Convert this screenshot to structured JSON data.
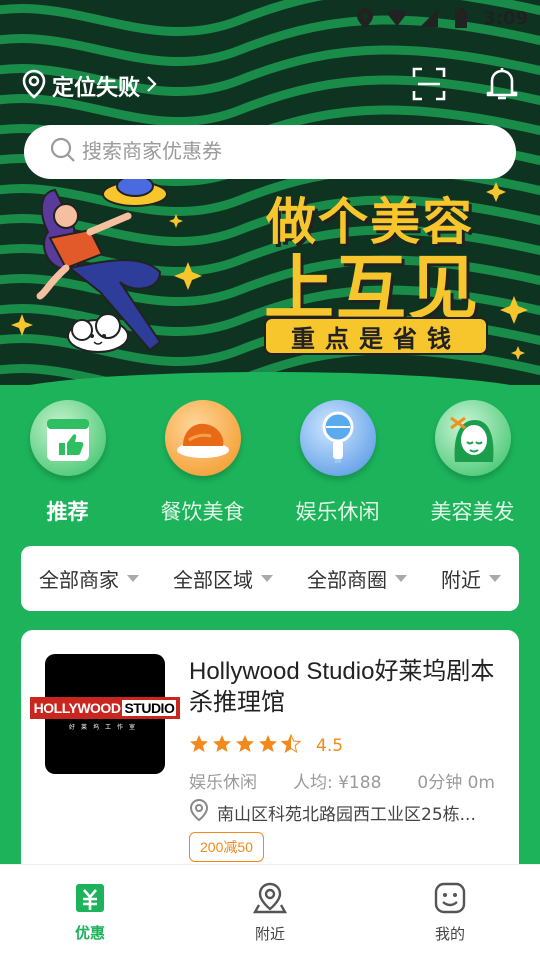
{
  "status": {
    "time": "3:09"
  },
  "header": {
    "location_label": "定位失败"
  },
  "search": {
    "placeholder": "搜索商家优惠券"
  },
  "banner": {
    "line1": "做个美容",
    "line2": "上互见",
    "pill": "重点是省钱"
  },
  "categories": [
    {
      "label": "推荐",
      "active": true
    },
    {
      "label": "餐饮美食",
      "active": false
    },
    {
      "label": "娱乐休闲",
      "active": false
    },
    {
      "label": "美容美发",
      "active": false
    }
  ],
  "filters": [
    "全部商家",
    "全部区域",
    "全部商圈",
    "附近"
  ],
  "merchant": {
    "name": "Hollywood Studio好莱坞剧本杀推理馆",
    "logo_text_1": "HOLLYWOOD",
    "logo_text_2": "STUDIO",
    "logo_sub": "好莱坞工作室",
    "rating": 4.5,
    "rating_text": "4.5",
    "category": "娱乐休闲",
    "avg_price": "人均: ¥188",
    "distance": "0分钟 0m",
    "address": "南山区科苑北路园西工业区25栋...",
    "tag": "200减50"
  },
  "bottom_nav": [
    {
      "label": "优惠",
      "icon": "coupon-icon",
      "active": true
    },
    {
      "label": "附近",
      "icon": "nearby-icon",
      "active": false
    },
    {
      "label": "我的",
      "icon": "profile-icon",
      "active": false
    }
  ],
  "colors": {
    "green": "#1cb35b",
    "yellow": "#f7c52c",
    "orange": "#f08a1d"
  }
}
